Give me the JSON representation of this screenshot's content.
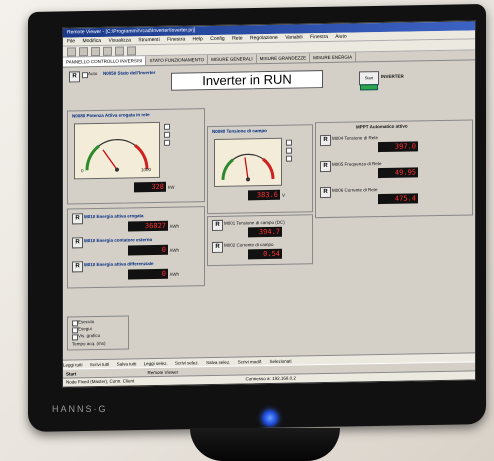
{
  "window": {
    "title": "Remote Viewer - [C:\\Programmi\\Vcad\\Inverter\\Inverter.prj]",
    "menu": [
      "File",
      "Modifica",
      "Visualizza",
      "Strumenti",
      "Finestra",
      "Help",
      "Config",
      "Rete",
      "Regolazione",
      "Variabili",
      "Finestra",
      "Aiuto"
    ],
    "tabs": [
      "PANNELLO CONTROLLO INVERSISI",
      "STATO FUNZIONAMENTO",
      "MISURE GENERALI",
      "MISURE GRANDEZZE",
      "MISURE ENERGIA"
    ]
  },
  "header": {
    "r_label": "R",
    "auto_label": "Auto",
    "status_label": "N0050 Stato dell'Inverter",
    "banner": "Inverter in RUN",
    "start_label": "Start",
    "inverter_label": "INVERTER"
  },
  "panel_power": {
    "title": "N0080 Potenza Attiva erogata in rete",
    "value": "328",
    "unit": "kW",
    "gauge_min": "0",
    "gauge_max": "1000"
  },
  "panel_field": {
    "title": "N0080 Tensione di campo",
    "value": "383.6",
    "unit": "V",
    "gauge_min": "0",
    "gauge_max": "1000"
  },
  "panel_grid": {
    "title": "MPPT Automatico attivo",
    "rows": [
      {
        "label": "M004 Tensione di Rete",
        "value": "397.0"
      },
      {
        "label": "M005 Frequenza di Rete",
        "value": "49.95"
      },
      {
        "label": "M006 Corrente di Rete",
        "value": "475.4"
      }
    ]
  },
  "energy": {
    "rows": [
      {
        "label": "M010 Energia attiva erogata",
        "value": "36027",
        "unit": "kWh"
      },
      {
        "label": "M010 Energia contatore esterno",
        "value": "0",
        "unit": "kWh"
      },
      {
        "label": "M010 Energia attiva differenziale",
        "value": "0",
        "unit": "kWh"
      }
    ],
    "current_rows": [
      {
        "label": "M001 Tensione di campo (DC)",
        "value": "394.7"
      },
      {
        "label": "M002 Corrente di campo",
        "value": "0.54"
      }
    ]
  },
  "options": {
    "checkbox_labels": [
      "Esecuto",
      "Esegui",
      "Vis. grafico"
    ],
    "tempo_label": "Tempo acq. (ms)"
  },
  "bottom_buttons": [
    "Leggi tutti",
    "Scrivi tutti",
    "Salva tutti",
    "Leggi selez.",
    "Scrivi selez.",
    "Salva selez.",
    "Scrivi modif.",
    "Selezionati"
  ],
  "taskbar": {
    "start": "Start",
    "app": "Remote Viewer"
  },
  "statusbar": {
    "left": "Node Fixed (Master), Conn. Client",
    "right": "Connesso a: 192.168.0.2"
  },
  "monitor": {
    "brand": "HANNS·G"
  }
}
